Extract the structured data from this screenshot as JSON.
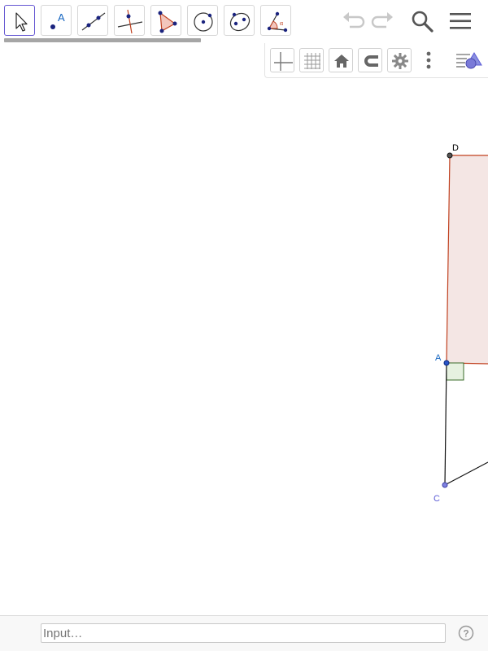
{
  "toolbar": {
    "tools": [
      {
        "name": "move-tool",
        "selected": true
      },
      {
        "name": "point-tool",
        "label": "A"
      },
      {
        "name": "line-tool"
      },
      {
        "name": "perpendicular-line-tool"
      },
      {
        "name": "polygon-tool"
      },
      {
        "name": "circle-center-point-tool"
      },
      {
        "name": "conic-tool"
      },
      {
        "name": "angle-tool",
        "label": "α"
      }
    ],
    "actions": [
      "undo-icon",
      "redo-icon",
      "search-icon",
      "menu-icon"
    ]
  },
  "style_bar": {
    "buttons": [
      "axes-icon",
      "grid-icon",
      "home-icon",
      "magnet-icon",
      "gear-icon",
      "more-vertical-icon",
      "style-bar-toggle-icon"
    ]
  },
  "graphics": {
    "points": {
      "D": {
        "label": "D",
        "color": "#000000"
      },
      "A": {
        "label": "A",
        "color": "#1565c0"
      },
      "C": {
        "label": "C",
        "color": "#5b5bd6"
      }
    },
    "polygon_fill": "#f4e6e4",
    "polygon_stroke": "#c0401f"
  },
  "input_bar": {
    "placeholder": "Input…"
  }
}
